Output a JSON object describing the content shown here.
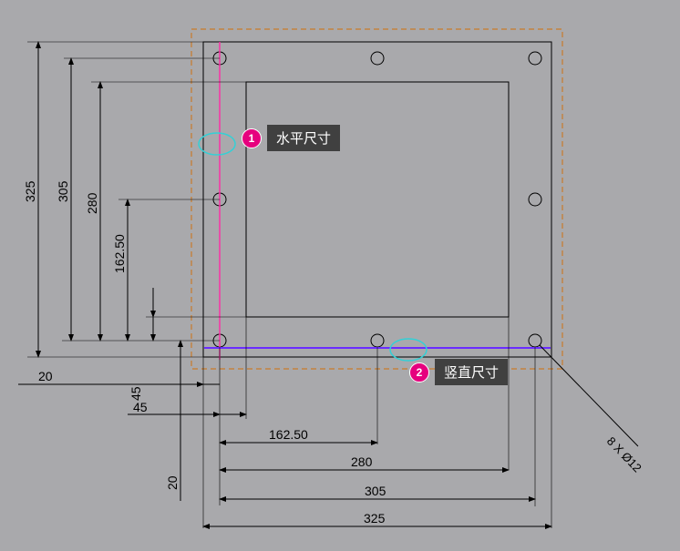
{
  "callouts": [
    {
      "num": "1",
      "label": "水平尺寸"
    },
    {
      "num": "2",
      "label": "竖直尺寸"
    }
  ],
  "dims_vertical": [
    "325",
    "305",
    "280",
    "162.50",
    "45",
    "20"
  ],
  "dims_horizontal": [
    "20",
    "45",
    "162.50",
    "280",
    "305",
    "325"
  ],
  "hole_note": "8 X Ø12"
}
